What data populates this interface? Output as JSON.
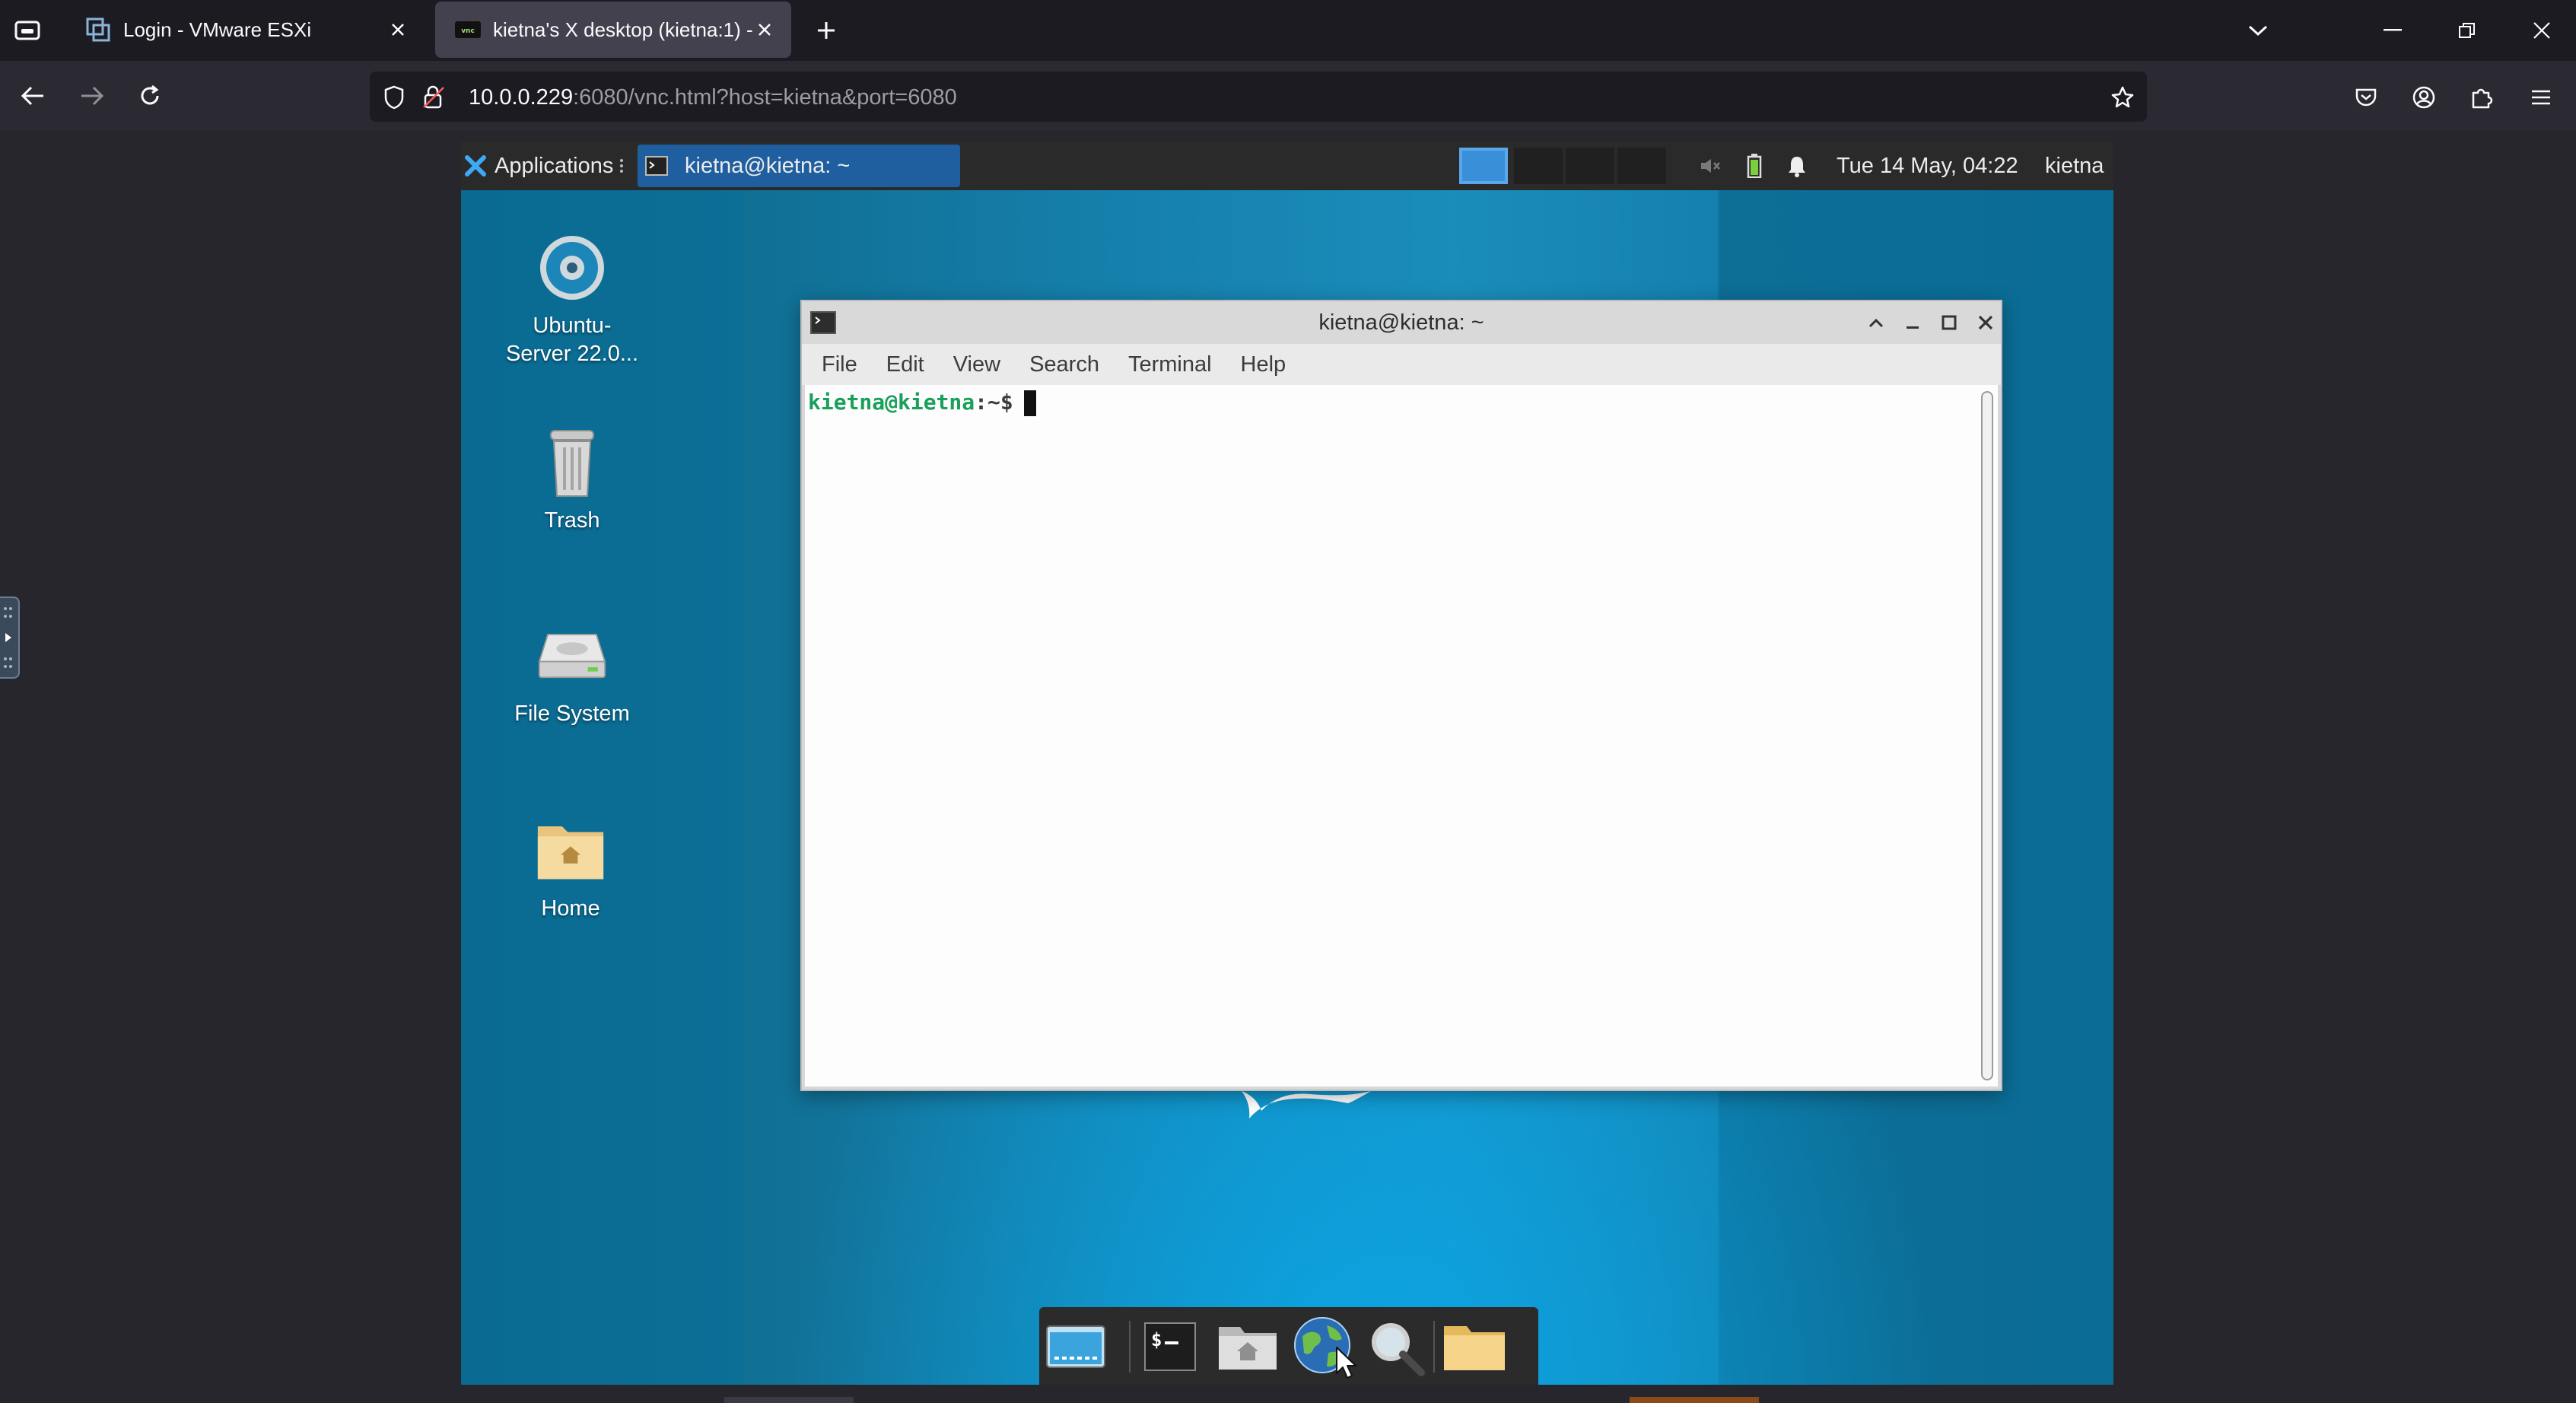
{
  "browser": {
    "tabs": [
      {
        "title": "Login - VMware ESXi",
        "active": false
      },
      {
        "title": "kietna's X desktop (kietna:1) - n",
        "active": true
      }
    ],
    "url": {
      "host": "10.0.0.229",
      "rest": ":6080/vnc.html?host=kietna&port=6080"
    }
  },
  "desktop": {
    "panel": {
      "applications_label": "Applications",
      "task_label": "kietna@kietna: ~",
      "clock": "Tue 14 May, 04:22",
      "user": "kietna"
    },
    "icons": [
      {
        "label": "Ubuntu-\nServer 22.0...",
        "icon": "disc-icon"
      },
      {
        "label": "Trash",
        "icon": "trash-icon"
      },
      {
        "label": "File System",
        "icon": "hard-drive-icon"
      },
      {
        "label": "Home",
        "icon": "home-folder-icon"
      }
    ],
    "terminal": {
      "title": "kietna@kietna: ~",
      "menu": [
        "File",
        "Edit",
        "View",
        "Search",
        "Terminal",
        "Help"
      ],
      "prompt_user": "kietna@kietna",
      "prompt_path": ":~$"
    },
    "dock": [
      "show-desktop-icon",
      "terminal-icon",
      "home-folder-icon",
      "web-browser-icon",
      "search-icon",
      "folder-icon"
    ]
  },
  "colors": {
    "accent": "#1f5f9f",
    "prompt_green": "#19a05a",
    "desktop_blue": "#1580ac"
  }
}
